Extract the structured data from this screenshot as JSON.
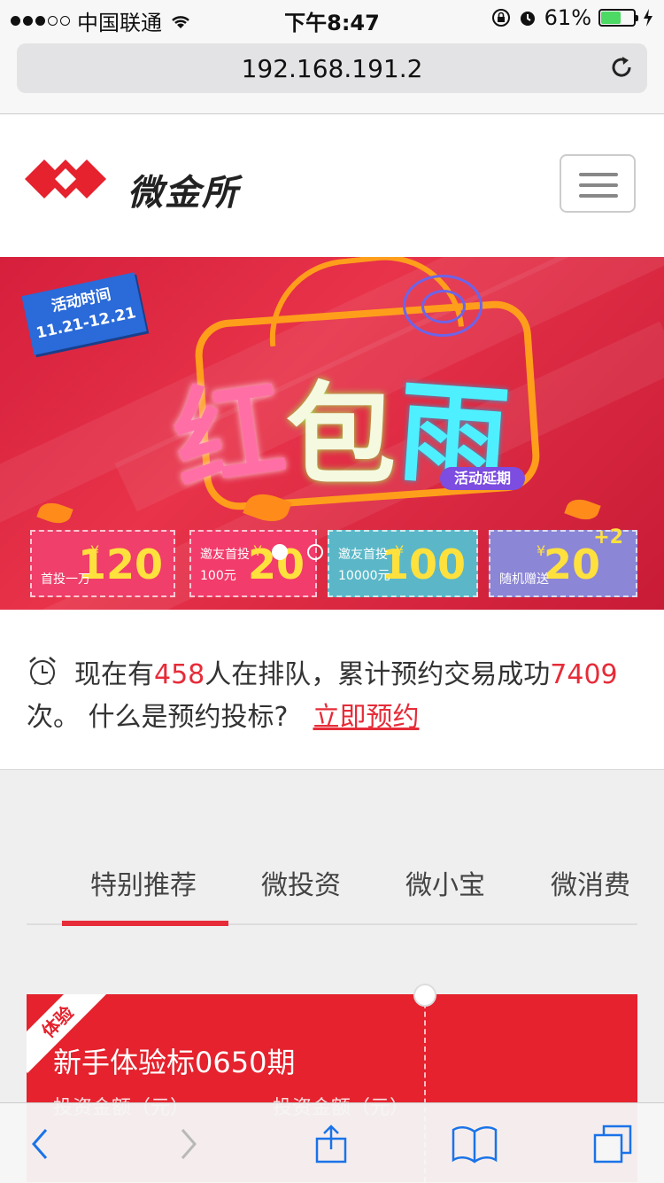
{
  "status_bar": {
    "carrier": "中国联通",
    "time": "下午8:47",
    "battery_percent": "61%",
    "battery_level": 0.61
  },
  "browser": {
    "url": "192.168.191.2"
  },
  "header": {
    "logo_text": "微金所"
  },
  "banner": {
    "activity_time_label": "活动时间",
    "activity_time_range": "11.21-12.21",
    "title_chars": [
      "红",
      "包",
      "雨"
    ],
    "extension_badge": "活动延期",
    "coupons": [
      {
        "amount": "120",
        "desc_line1": "首投一万",
        "desc_line2": ""
      },
      {
        "amount": "20",
        "desc_line1": "邀友首投",
        "desc_line2": "100元"
      },
      {
        "amount": "100",
        "desc_line1": "邀友首投",
        "desc_line2": "10000元"
      },
      {
        "amount": "20",
        "desc_line1": "随机赠送",
        "desc_line2": "",
        "extra": "+2"
      }
    ],
    "currency_symbol": "¥",
    "pager_count": 2,
    "pager_active": 0
  },
  "queue": {
    "prefix": "现在有",
    "queue_count": "458",
    "middle": "人在排队，累计预约交易成功",
    "success_count": "7409",
    "suffix": "次。 什么是预约投标?",
    "action_link": "立即预约"
  },
  "tabs": {
    "items": [
      "特别推荐",
      "微投资",
      "微小宝",
      "微消费"
    ],
    "active": 0
  },
  "product_card": {
    "ribbon": "体验",
    "title": "新手体验标0650期",
    "sub_left": "投资金额（元）",
    "sub_right": "投资金额（元）"
  }
}
